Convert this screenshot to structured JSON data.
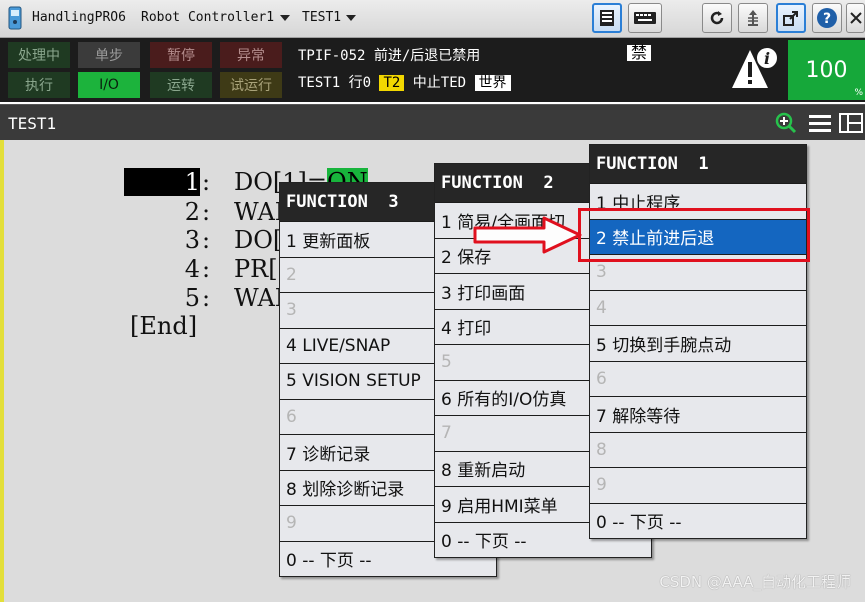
{
  "titlebar": {
    "app_name": "HandlingPRO6",
    "controller": "Robot Controller1",
    "program": "TEST1",
    "icons": [
      "teach-pendant-icon",
      "display-icon",
      "keyboard-icon",
      "rotate-icon",
      "jog-icon",
      "external-link-icon",
      "help-icon",
      "close-icon"
    ]
  },
  "status": {
    "leds_top": [
      "处理中",
      "单步",
      "暂停",
      "异常"
    ],
    "leds_bottom": [
      "执行",
      "I/O",
      "运转",
      "试运行"
    ],
    "alarm_line": "TPIF-052 前进/后退已禁用",
    "alarm_flag": "禁",
    "prog_name": "TEST1",
    "line_label": "行0",
    "task_tag": "T2",
    "state": "中止TED",
    "coord": "世界",
    "override": "100",
    "override_unit": "%",
    "colors": {
      "lit_green": "#1cb33c",
      "task_yellow": "#f2d700",
      "override_green": "#16a83a"
    }
  },
  "screen": {
    "title": "TEST1",
    "icons": [
      "zoom-in-icon",
      "list-view-icon",
      "split-view-icon"
    ]
  },
  "program": {
    "lines": [
      {
        "num": "1",
        "code": "DO[1]=ON"
      },
      {
        "num": "2",
        "code": "WAI"
      },
      {
        "num": "3",
        "code": "DO["
      },
      {
        "num": "4",
        "code": "PR["
      },
      {
        "num": "5",
        "code": "WAI"
      }
    ],
    "end_label": "[End]"
  },
  "menus": [
    {
      "title": "FUNCTION  3",
      "items": [
        "1 更新面板",
        "2",
        "3",
        "4 LIVE/SNAP",
        "5 VISION SETUP",
        "6",
        "7 诊断记录",
        "8 划除诊断记录",
        "9",
        "0 -- 下页 --"
      ]
    },
    {
      "title": "FUNCTION  2",
      "items": [
        "1 简易/全画面切",
        "2 保存",
        "3 打印画面",
        "4 打印",
        "5",
        "6 所有的I/O仿真",
        "7",
        "8 重新启动",
        "9 启用HMI菜单",
        "0 -- 下页 --"
      ]
    },
    {
      "title": "FUNCTION  1",
      "items": [
        "1 中止程序",
        "2 禁止前进后退",
        "3",
        "4",
        "5 切换到手腕点动",
        "6",
        "7 解除等待",
        "8",
        "9",
        "0 -- 下页 --"
      ],
      "selected": "2 禁止前进后退"
    }
  ],
  "annotation": {
    "arrow_color": "#e0101e",
    "box_color": "#e0101e"
  },
  "watermark": "CSDN @AAA_自动化工程师"
}
